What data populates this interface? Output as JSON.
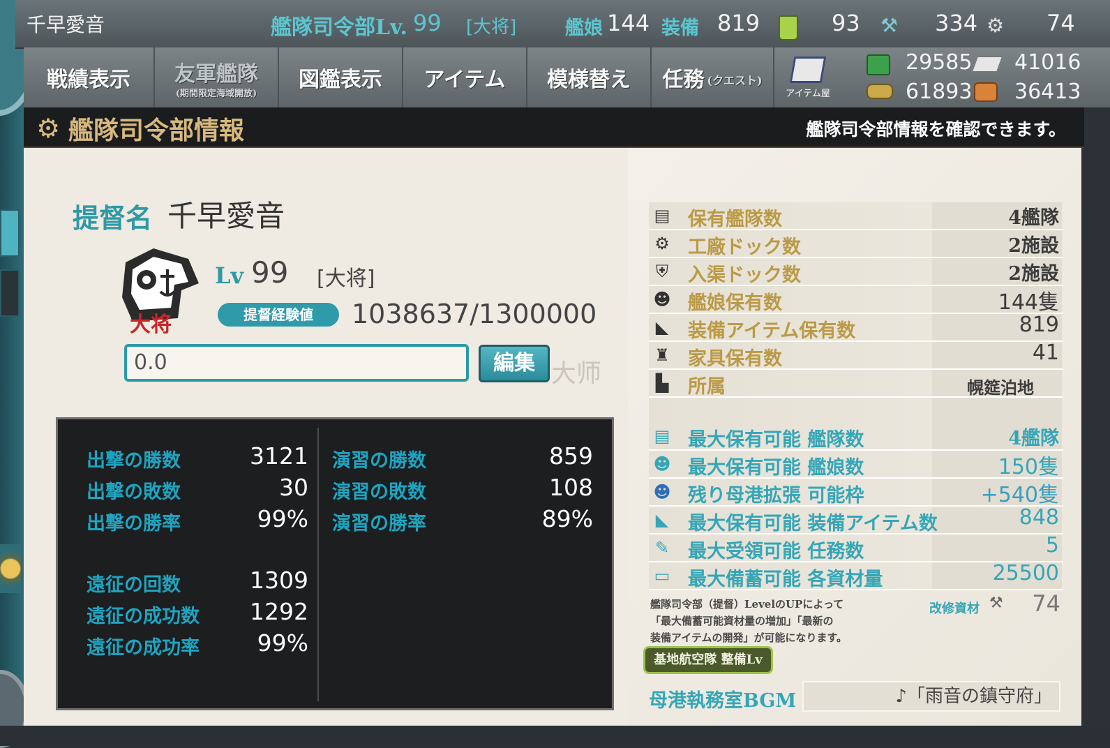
{
  "topbar": {
    "admiral_name": "千早愛音",
    "hq_label": "艦隊司令部Lv.",
    "hq_level": "99",
    "rank": "[大将]",
    "ships_label": "艦娘",
    "ships_count": "144",
    "equip_label": "装備",
    "equip_count": "819",
    "bucket_count": "93",
    "devmat_count": "334",
    "screw_count": "74"
  },
  "menu": {
    "items": [
      {
        "label": "戦績表示"
      },
      {
        "label": "友軍艦隊",
        "sub": "(期間限定海域開放)"
      },
      {
        "label": "図鑑表示"
      },
      {
        "label": "アイテム"
      },
      {
        "label": "模様替え"
      },
      {
        "label": "任務",
        "sub": "(クエスト)"
      }
    ],
    "shop_label": "アイテム屋"
  },
  "resources": {
    "fuel": "29585",
    "steel": "41016",
    "ammo": "61893",
    "bauxite": "36413"
  },
  "header": {
    "title": "艦隊司令部情報",
    "description": "艦隊司令部情報を確認できます。"
  },
  "profile": {
    "name_label": "提督名",
    "name": "千早愛音",
    "lv_label": "Lv",
    "level": "99",
    "rank": "[大将]",
    "emblem_text": "大将",
    "exp_label": "提督経験値",
    "exp_value": "1038637/1300000",
    "comment_value": "0.0",
    "edit_button": "編集",
    "watermark": "大师"
  },
  "stats": {
    "sortie_wins_label": "出撃の勝数",
    "sortie_wins": "3121",
    "sortie_losses_label": "出撃の敗数",
    "sortie_losses": "30",
    "sortie_rate_label": "出撃の勝率",
    "sortie_rate": "99%",
    "exercise_wins_label": "演習の勝数",
    "exercise_wins": "859",
    "exercise_losses_label": "演習の敗数",
    "exercise_losses": "108",
    "exercise_rate_label": "演習の勝率",
    "exercise_rate": "89%",
    "expedition_count_label": "遠征の回数",
    "expedition_count": "1309",
    "expedition_success_label": "遠征の成功数",
    "expedition_success": "1292",
    "expedition_rate_label": "遠征の成功率",
    "expedition_rate": "99%"
  },
  "info": {
    "rows": [
      {
        "label": "保有艦隊数",
        "value": "4艦隊",
        "icon": "fleet-icon"
      },
      {
        "label": "工廠ドック数",
        "value": "2施設",
        "icon": "gear-icon"
      },
      {
        "label": "入渠ドック数",
        "value": "2施設",
        "icon": "repair-icon"
      },
      {
        "label": "艦娘保有数",
        "value": "144隻",
        "icon": "shipgirl-icon"
      },
      {
        "label": "装備アイテム保有数",
        "value": "819",
        "icon": "equipment-icon"
      },
      {
        "label": "家具保有数",
        "value": "41",
        "icon": "furniture-icon"
      },
      {
        "label": "所属",
        "value": "幌筵泊地",
        "icon": "base-icon"
      }
    ],
    "max_rows": [
      {
        "label": "最大保有可能 艦隊数",
        "value": "4艦隊",
        "icon": "fleet-icon"
      },
      {
        "label": "最大保有可能 艦娘数",
        "value": "150隻",
        "icon": "shipgirl-icon"
      },
      {
        "label": "残り母港拡張 可能枠",
        "value": "+540隻",
        "icon": "port-expansion-icon"
      },
      {
        "label": "最大保有可能 装備アイテム数",
        "value": "848",
        "icon": "equipment-icon"
      },
      {
        "label": "最大受領可能 任務数",
        "value": "5",
        "icon": "quest-icon"
      },
      {
        "label": "最大備蓄可能 各資材量",
        "value": "25500",
        "icon": "storage-icon"
      }
    ],
    "note_line1": "艦隊司令部（提督）LevelのUPによって",
    "note_line2": "「最大備蓄可能資材量の増加」「最新の",
    "note_line3": "装備アイテムの開発」が可能になります。",
    "improvement_label": "改修資材",
    "improvement_value": "74",
    "lbas_button": "基地航空隊 整備Lv",
    "bgm_label": "母港執務室BGM",
    "bgm_value": "♪「雨音の鎮守府」"
  }
}
